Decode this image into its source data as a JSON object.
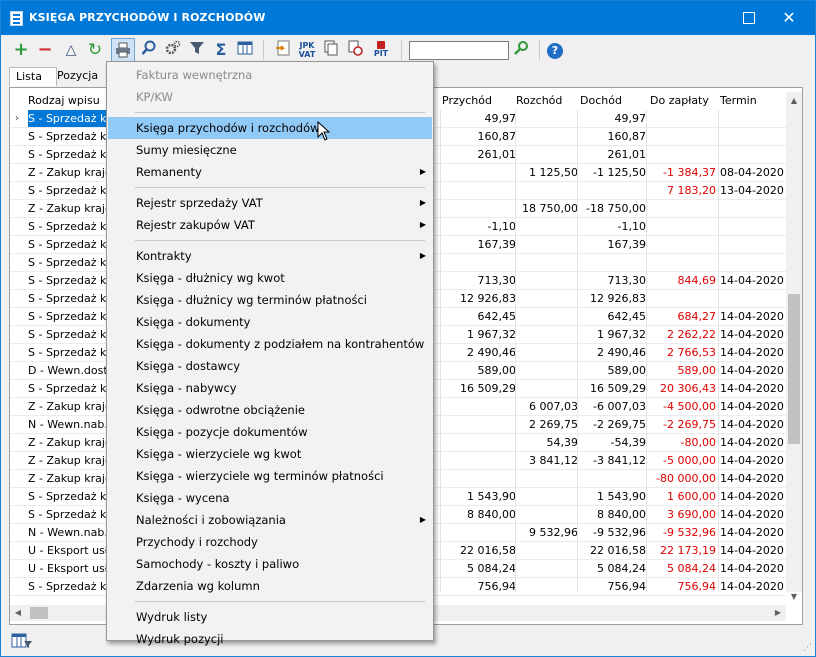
{
  "window": {
    "title": "KSIĘGA PRZYCHODÓW I ROZCHODÓW",
    "maximize_icon": "maximize-icon",
    "close_icon": "close-icon",
    "close_glyph": "✕"
  },
  "toolbar": {
    "add_icon": "+",
    "remove_icon": "−",
    "filter_icon": "△",
    "refresh_icon": "↻",
    "print_icon": "print-icon",
    "find_icon": "search-icon",
    "settings_icon": "gear-icon",
    "funnel_icon": "funnel-icon",
    "sum_icon": "Σ",
    "columns_icon": "columns-icon",
    "jpk_label_top": "JPK",
    "jpk_label_bottom": "VAT",
    "pit_label": "PIT",
    "search_value": "",
    "help_icon": "?"
  },
  "tabs": [
    "Lista",
    "Pozycja"
  ],
  "columns": {
    "rodzaj": "Rodzaj wpisu",
    "przychod": "Przychód",
    "rozchod": "Rozchód",
    "dochod": "Dochód",
    "do_zaplaty": "Do zapłaty",
    "termin": "Termin"
  },
  "rows": [
    {
      "rodzaj": "S - Sprzedaż kraj",
      "przychod": "49,97",
      "rozchod": "",
      "dochod": "49,97",
      "do_zaplaty": "",
      "termin": ""
    },
    {
      "rodzaj": "S - Sprzedaż kraj",
      "przychod": "160,87",
      "rozchod": "",
      "dochod": "160,87",
      "do_zaplaty": "",
      "termin": ""
    },
    {
      "rodzaj": "S - Sprzedaż kraj",
      "przychod": "261,01",
      "rozchod": "",
      "dochod": "261,01",
      "do_zaplaty": "",
      "termin": ""
    },
    {
      "rodzaj": "Z - Zakup krajow",
      "przychod": "",
      "rozchod": "1 125,50",
      "dochod": "-1 125,50",
      "do_zaplaty": "-1 384,37",
      "termin": "08-04-2020"
    },
    {
      "rodzaj": "S - Sprzedaż kraj",
      "przychod": "",
      "rozchod": "",
      "dochod": "",
      "do_zaplaty": "7 183,20",
      "termin": "13-04-2020"
    },
    {
      "rodzaj": "Z - Zakup krajow",
      "przychod": "",
      "rozchod": "18 750,00",
      "dochod": "-18 750,00",
      "do_zaplaty": "",
      "termin": ""
    },
    {
      "rodzaj": "S - Sprzedaż kraj",
      "przychod": "-1,10",
      "rozchod": "",
      "dochod": "-1,10",
      "do_zaplaty": "",
      "termin": ""
    },
    {
      "rodzaj": "S - Sprzedaż kraj",
      "przychod": "167,39",
      "rozchod": "",
      "dochod": "167,39",
      "do_zaplaty": "",
      "termin": ""
    },
    {
      "rodzaj": "S - Sprzedaż kraj",
      "przychod": "",
      "rozchod": "",
      "dochod": "",
      "do_zaplaty": "",
      "termin": ""
    },
    {
      "rodzaj": "S - Sprzedaż kraj",
      "przychod": "713,30",
      "rozchod": "",
      "dochod": "713,30",
      "do_zaplaty": "844,69",
      "termin": "14-04-2020"
    },
    {
      "rodzaj": "S - Sprzedaż kraj",
      "przychod": "12 926,83",
      "rozchod": "",
      "dochod": "12 926,83",
      "do_zaplaty": "",
      "termin": ""
    },
    {
      "rodzaj": "S - Sprzedaż kraj",
      "przychod": "642,45",
      "rozchod": "",
      "dochod": "642,45",
      "do_zaplaty": "684,27",
      "termin": "14-04-2020"
    },
    {
      "rodzaj": "S - Sprzedaż kraj",
      "przychod": "1 967,32",
      "rozchod": "",
      "dochod": "1 967,32",
      "do_zaplaty": "2 262,22",
      "termin": "14-04-2020"
    },
    {
      "rodzaj": "S - Sprzedaż kraj",
      "przychod": "2 490,46",
      "rozchod": "",
      "dochod": "2 490,46",
      "do_zaplaty": "2 766,53",
      "termin": "14-04-2020"
    },
    {
      "rodzaj": "D - Wewn.dost.t",
      "przychod": "589,00",
      "rozchod": "",
      "dochod": "589,00",
      "do_zaplaty": "589,00",
      "termin": "14-04-2020"
    },
    {
      "rodzaj": "S - Sprzedaż kraj",
      "przychod": "16 509,29",
      "rozchod": "",
      "dochod": "16 509,29",
      "do_zaplaty": "20 306,43",
      "termin": "14-04-2020"
    },
    {
      "rodzaj": "Z - Zakup krajow",
      "przychod": "",
      "rozchod": "6 007,03",
      "dochod": "-6 007,03",
      "do_zaplaty": "-4 500,00",
      "termin": "14-04-2020"
    },
    {
      "rodzaj": "N - Wewn.nab.to",
      "przychod": "",
      "rozchod": "2 269,75",
      "dochod": "-2 269,75",
      "do_zaplaty": "-2 269,75",
      "termin": "14-04-2020"
    },
    {
      "rodzaj": "Z - Zakup krajow",
      "przychod": "",
      "rozchod": "54,39",
      "dochod": "-54,39",
      "do_zaplaty": "-80,00",
      "termin": "14-04-2020"
    },
    {
      "rodzaj": "Z - Zakup krajow",
      "przychod": "",
      "rozchod": "3 841,12",
      "dochod": "-3 841,12",
      "do_zaplaty": "-5 000,00",
      "termin": "14-04-2020"
    },
    {
      "rodzaj": "Z - Zakup krajow",
      "przychod": "",
      "rozchod": "",
      "dochod": "",
      "do_zaplaty": "-80 000,00",
      "termin": "14-04-2020"
    },
    {
      "rodzaj": "S - Sprzedaż kraj",
      "przychod": "1 543,90",
      "rozchod": "",
      "dochod": "1 543,90",
      "do_zaplaty": "1 600,00",
      "termin": "14-04-2020"
    },
    {
      "rodzaj": "S - Sprzedaż kraj",
      "przychod": "8 840,00",
      "rozchod": "",
      "dochod": "8 840,00",
      "do_zaplaty": "3 690,00",
      "termin": "14-04-2020"
    },
    {
      "rodzaj": "N - Wewn.nab.to",
      "przychod": "",
      "rozchod": "9 532,96",
      "dochod": "-9 532,96",
      "do_zaplaty": "-9 532,96",
      "termin": "14-04-2020"
    },
    {
      "rodzaj": "U - Eksport usług",
      "przychod": "22 016,58",
      "rozchod": "",
      "dochod": "22 016,58",
      "do_zaplaty": "22 173,19",
      "termin": "14-04-2020"
    },
    {
      "rodzaj": "U - Eksport usług",
      "przychod": "5 084,24",
      "rozchod": "",
      "dochod": "5 084,24",
      "do_zaplaty": "5 084,24",
      "termin": "14-04-2020"
    },
    {
      "rodzaj": "S - Sprzedaż kraj",
      "przychod": "756,94",
      "rozchod": "",
      "dochod": "756,94",
      "do_zaplaty": "756,94",
      "termin": "14-04-2020"
    }
  ],
  "menu": [
    {
      "label": "Faktura wewnętrzna",
      "disabled": true
    },
    {
      "label": "KP/KW",
      "disabled": true
    },
    {
      "sep": true
    },
    {
      "label": "Księga przychodów i rozchodów",
      "highlighted": true
    },
    {
      "label": "Sumy miesięczne"
    },
    {
      "label": "Remanenty",
      "submenu": true
    },
    {
      "sep": true
    },
    {
      "label": "Rejestr sprzedaży VAT",
      "submenu": true
    },
    {
      "label": "Rejestr zakupów VAT",
      "submenu": true
    },
    {
      "sep": true
    },
    {
      "label": "Kontrakty",
      "submenu": true
    },
    {
      "label": "Księga - dłużnicy wg kwot"
    },
    {
      "label": "Księga - dłużnicy wg terminów płatności"
    },
    {
      "label": "Księga - dokumenty"
    },
    {
      "label": "Księga - dokumenty z podziałem na kontrahentów"
    },
    {
      "label": "Księga - dostawcy"
    },
    {
      "label": "Księga - nabywcy"
    },
    {
      "label": "Księga - odwrotne obciążenie"
    },
    {
      "label": "Księga - pozycje dokumentów"
    },
    {
      "label": "Księga - wierzyciele wg kwot"
    },
    {
      "label": "Księga - wierzyciele wg terminów płatności"
    },
    {
      "label": "Księga - wycena"
    },
    {
      "label": "Należności i zobowiązania",
      "submenu": true
    },
    {
      "label": "Przychody i rozchody"
    },
    {
      "label": "Samochody - koszty i paliwo"
    },
    {
      "label": "Zdarzenia wg kolumn"
    },
    {
      "sep": true
    },
    {
      "label": "Wydruk listy"
    },
    {
      "label": "Wydruk pozycji"
    }
  ],
  "colors": {
    "titlebar": "#0078d7",
    "selection": "#0078d7",
    "menu_highlight": "#91c9f7",
    "negative_due": "#e00000"
  }
}
